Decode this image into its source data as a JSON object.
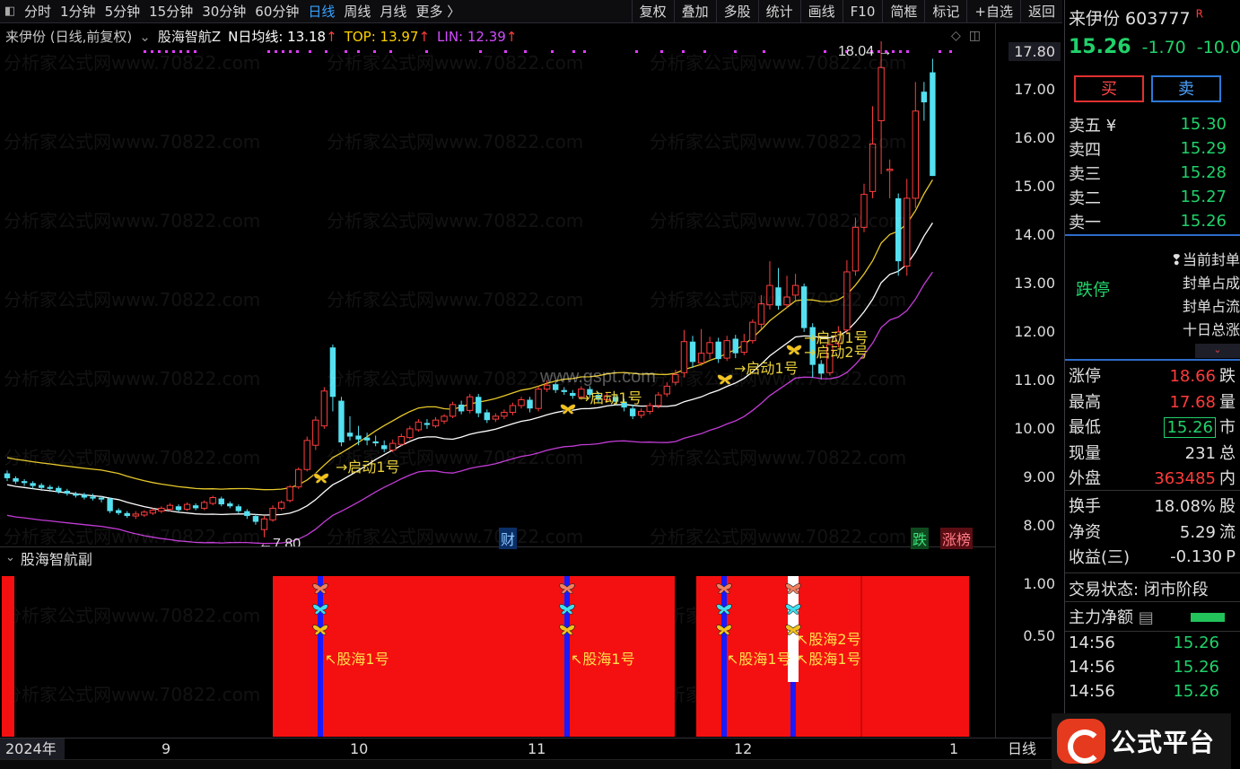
{
  "toolbar": {
    "periods": [
      "分时",
      "1分钟",
      "5分钟",
      "15分钟",
      "30分钟",
      "60分钟",
      "日线",
      "周线",
      "月线",
      "更多 〉"
    ],
    "active_period": "日线",
    "buttons": [
      "复权",
      "叠加",
      "多股",
      "统计",
      "画线",
      "F10",
      "简框",
      "标记",
      "+自选",
      "返回"
    ]
  },
  "chart": {
    "name": "来伊份 (日线,前复权)",
    "indicator": "股海智航Z",
    "ma_label": "N日均线: 13.18",
    "top_label": "TOP: 13.97",
    "lin_label": "LIN: 12.39",
    "high_marker": "18.04",
    "low_marker": "7.80",
    "axis_current": "17.80",
    "axis_ticks": [
      "17.00",
      "16.00",
      "15.00",
      "14.00",
      "13.00",
      "12.00",
      "11.00",
      "10.00",
      "9.00",
      "8.00"
    ],
    "watermark_text": "分析家公式网www.70822.com",
    "center_watermark": "www.gspt.com",
    "signal_label": "→启动1号",
    "signal_label_2": "→启动2号",
    "tag_cai": "财",
    "tag_die": "跌",
    "tag_zhangbang": "涨榜"
  },
  "sub_chart": {
    "name": "股海智航副",
    "axis_ticks": [
      "1.00",
      "0.50"
    ],
    "signal_1": "股海1号",
    "signal_2": "股海2号"
  },
  "xaxis": {
    "year": "2024年",
    "months": [
      "9",
      "10",
      "11",
      "12",
      "1"
    ],
    "right_label": "日线"
  },
  "quote": {
    "title": "来伊份 603777",
    "badge": "R",
    "price": "15.26",
    "change": "-1.70",
    "change_pct": "-10.0",
    "buy_label": "买",
    "sell_label": "卖",
    "order_book": [
      {
        "name": "卖五 ¥",
        "price": "15.30"
      },
      {
        "name": "卖四",
        "price": "15.29"
      },
      {
        "name": "卖三",
        "price": "15.28"
      },
      {
        "name": "卖二",
        "price": "15.27"
      },
      {
        "name": "卖一",
        "price": "15.26"
      }
    ],
    "limit_status": "跌停",
    "limit_info": [
      "❢当前封单",
      "封单占成",
      "封单占流",
      "十日总涨"
    ],
    "stats_a": [
      {
        "name": "涨停",
        "value": "18.66",
        "suffix": "跌",
        "color": "red"
      },
      {
        "name": "最高",
        "value": "17.68",
        "suffix": "量",
        "color": "red"
      },
      {
        "name": "最低",
        "value": "15.26",
        "suffix": "市",
        "color": "green",
        "boxed": true
      },
      {
        "name": "现量",
        "value": "231",
        "suffix": "总",
        "color": "white"
      },
      {
        "name": "外盘",
        "value": "363485",
        "suffix": "内",
        "color": "red"
      }
    ],
    "stats_b": [
      {
        "name": "换手",
        "value": "18.08%",
        "suffix": "股",
        "color": "white"
      },
      {
        "name": "净资",
        "value": "5.29",
        "suffix": "流",
        "color": "white"
      },
      {
        "name": "收益(三)",
        "value": "-0.130",
        "suffix": "P",
        "color": "white"
      }
    ],
    "trade_state": "交易状态: 闭市阶段",
    "main_flow": "主力净额",
    "ticks": [
      {
        "time": "14:56",
        "price": "15.26"
      },
      {
        "time": "14:56",
        "price": "15.26"
      },
      {
        "time": "14:56",
        "price": "15.26"
      }
    ]
  },
  "logo": {
    "text": "公式平台"
  },
  "chart_data": {
    "type": "candlestick",
    "title": "来伊份 (日线,前复权)",
    "ylim": [
      7.5,
      18.2
    ],
    "candles": [
      [
        9.12,
        9.02,
        9.18,
        8.96
      ],
      [
        9.02,
        8.95,
        9.06,
        8.9
      ],
      [
        8.96,
        8.92,
        9.0,
        8.86
      ],
      [
        8.92,
        8.86,
        8.96,
        8.8
      ],
      [
        8.88,
        8.82,
        8.92,
        8.76
      ],
      [
        8.84,
        8.8,
        8.88,
        8.74
      ],
      [
        8.82,
        8.74,
        8.86,
        8.7
      ],
      [
        8.76,
        8.7,
        8.8,
        8.66
      ],
      [
        8.7,
        8.66,
        8.74,
        8.62
      ],
      [
        8.68,
        8.62,
        8.72,
        8.58
      ],
      [
        8.64,
        8.6,
        8.7,
        8.56
      ],
      [
        8.62,
        8.58,
        8.66,
        8.52
      ],
      [
        8.6,
        8.34,
        8.62,
        8.3
      ],
      [
        8.36,
        8.3,
        8.4,
        8.26
      ],
      [
        8.3,
        8.24,
        8.34,
        8.2
      ],
      [
        8.24,
        8.28,
        8.34,
        8.18
      ],
      [
        8.26,
        8.32,
        8.36,
        8.22
      ],
      [
        8.3,
        8.36,
        8.4,
        8.26
      ],
      [
        8.34,
        8.4,
        8.44,
        8.3
      ],
      [
        8.38,
        8.46,
        8.5,
        8.34
      ],
      [
        8.44,
        8.36,
        8.48,
        8.32
      ],
      [
        8.38,
        8.48,
        8.52,
        8.34
      ],
      [
        8.46,
        8.4,
        8.5,
        8.36
      ],
      [
        8.4,
        8.52,
        8.56,
        8.36
      ],
      [
        8.5,
        8.62,
        8.66,
        8.46
      ],
      [
        8.6,
        8.48,
        8.64,
        8.44
      ],
      [
        8.5,
        8.44,
        8.54,
        8.4
      ],
      [
        8.44,
        8.34,
        8.48,
        8.3
      ],
      [
        8.34,
        8.24,
        8.38,
        8.18
      ],
      [
        8.24,
        8.12,
        8.28,
        8.06
      ],
      [
        7.96,
        8.18,
        8.24,
        7.8
      ],
      [
        8.16,
        8.4,
        8.46,
        8.12
      ],
      [
        8.4,
        8.52,
        8.56,
        8.36
      ],
      [
        8.56,
        8.84,
        8.88,
        8.52
      ],
      [
        8.84,
        9.2,
        9.24,
        8.8
      ],
      [
        9.2,
        9.8,
        9.88,
        9.16
      ],
      [
        9.7,
        10.22,
        10.3,
        9.6
      ],
      [
        10.1,
        10.82,
        10.9,
        10.04
      ],
      [
        11.72,
        10.7,
        11.78,
        10.4
      ],
      [
        10.62,
        9.76,
        10.7,
        9.68
      ],
      [
        9.96,
        9.88,
        10.3,
        9.8
      ],
      [
        9.9,
        9.82,
        10.1,
        9.7
      ],
      [
        9.86,
        9.8,
        9.96,
        9.7
      ],
      [
        9.78,
        9.74,
        9.9,
        9.68
      ],
      [
        9.7,
        9.62,
        9.8,
        9.56
      ],
      [
        9.6,
        9.74,
        9.82,
        9.56
      ],
      [
        9.72,
        9.88,
        9.94,
        9.68
      ],
      [
        9.86,
        10.04,
        10.1,
        9.82
      ],
      [
        10.02,
        10.18,
        10.24,
        9.98
      ],
      [
        10.16,
        10.12,
        10.24,
        10.04
      ],
      [
        10.1,
        10.22,
        10.28,
        10.06
      ],
      [
        10.2,
        10.3,
        10.34,
        10.14
      ],
      [
        10.3,
        10.54,
        10.6,
        10.26
      ],
      [
        10.54,
        10.4,
        10.62,
        10.34
      ],
      [
        10.42,
        10.7,
        10.76,
        10.36
      ],
      [
        10.7,
        10.36,
        10.76,
        10.28
      ],
      [
        10.38,
        10.22,
        10.44,
        10.16
      ],
      [
        10.24,
        10.3,
        10.36,
        10.18
      ],
      [
        10.3,
        10.38,
        10.44,
        10.24
      ],
      [
        10.38,
        10.52,
        10.58,
        10.32
      ],
      [
        10.52,
        10.64,
        10.7,
        10.46
      ],
      [
        10.64,
        10.46,
        10.7,
        10.38
      ],
      [
        10.46,
        10.86,
        10.92,
        10.4
      ],
      [
        10.86,
        10.94,
        11.04,
        10.8
      ],
      [
        10.96,
        10.84,
        11.0,
        10.78
      ],
      [
        10.84,
        10.8,
        10.9,
        10.74
      ],
      [
        10.78,
        10.72,
        10.84,
        10.66
      ],
      [
        10.7,
        10.86,
        10.92,
        10.64
      ],
      [
        10.86,
        10.74,
        10.92,
        10.68
      ],
      [
        10.74,
        10.64,
        10.8,
        10.58
      ],
      [
        10.64,
        10.72,
        10.78,
        10.58
      ],
      [
        10.7,
        10.6,
        10.76,
        10.52
      ],
      [
        10.6,
        10.48,
        10.66,
        10.4
      ],
      [
        10.46,
        10.3,
        10.54,
        10.24
      ],
      [
        10.32,
        10.4,
        10.46,
        10.26
      ],
      [
        10.4,
        10.52,
        10.58,
        10.34
      ],
      [
        10.52,
        10.74,
        10.8,
        10.46
      ],
      [
        10.76,
        10.92,
        11.0,
        10.7
      ],
      [
        11.0,
        11.16,
        11.26,
        10.94
      ],
      [
        11.2,
        11.84,
        12.08,
        11.1
      ],
      [
        11.84,
        11.42,
        11.96,
        11.3
      ],
      [
        11.4,
        11.6,
        12.1,
        11.34
      ],
      [
        11.6,
        11.82,
        11.94,
        11.48
      ],
      [
        11.84,
        11.48,
        11.92,
        11.4
      ],
      [
        11.5,
        11.86,
        11.96,
        11.44
      ],
      [
        11.9,
        11.6,
        11.98,
        11.5
      ],
      [
        11.62,
        11.84,
        12.0,
        11.56
      ],
      [
        11.86,
        12.24,
        12.3,
        11.8
      ],
      [
        12.2,
        12.62,
        12.8,
        12.1
      ],
      [
        12.6,
        13.0,
        13.5,
        12.5
      ],
      [
        12.96,
        12.58,
        13.36,
        12.5
      ],
      [
        12.6,
        12.76,
        13.2,
        12.54
      ],
      [
        12.8,
        13.0,
        13.24,
        12.7
      ],
      [
        12.98,
        12.12,
        13.04,
        12.04
      ],
      [
        12.14,
        11.36,
        12.22,
        11.1
      ],
      [
        11.38,
        11.18,
        11.46,
        11.06
      ],
      [
        11.2,
        11.78,
        11.9,
        11.14
      ],
      [
        11.8,
        12.04,
        12.16,
        11.72
      ],
      [
        12.08,
        13.28,
        13.52,
        12.0
      ],
      [
        13.3,
        14.2,
        14.4,
        13.2
      ],
      [
        14.2,
        14.88,
        15.1,
        14.1
      ],
      [
        14.94,
        15.92,
        16.7,
        14.8
      ],
      [
        16.4,
        17.5,
        18.04,
        15.3
      ],
      [
        15.4,
        15.4,
        15.6,
        14.8
      ],
      [
        14.8,
        13.5,
        14.9,
        13.2
      ],
      [
        13.4,
        14.8,
        15.2,
        13.2
      ],
      [
        14.8,
        16.6,
        17.2,
        14.6
      ],
      [
        17.0,
        16.78,
        17.2,
        16.4
      ],
      [
        17.4,
        15.26,
        17.68,
        15.26
      ]
    ],
    "series": [
      {
        "name": "N日均线",
        "last": 13.18
      },
      {
        "name": "TOP",
        "last": 13.97
      },
      {
        "name": "LIN",
        "last": 12.39
      }
    ]
  }
}
